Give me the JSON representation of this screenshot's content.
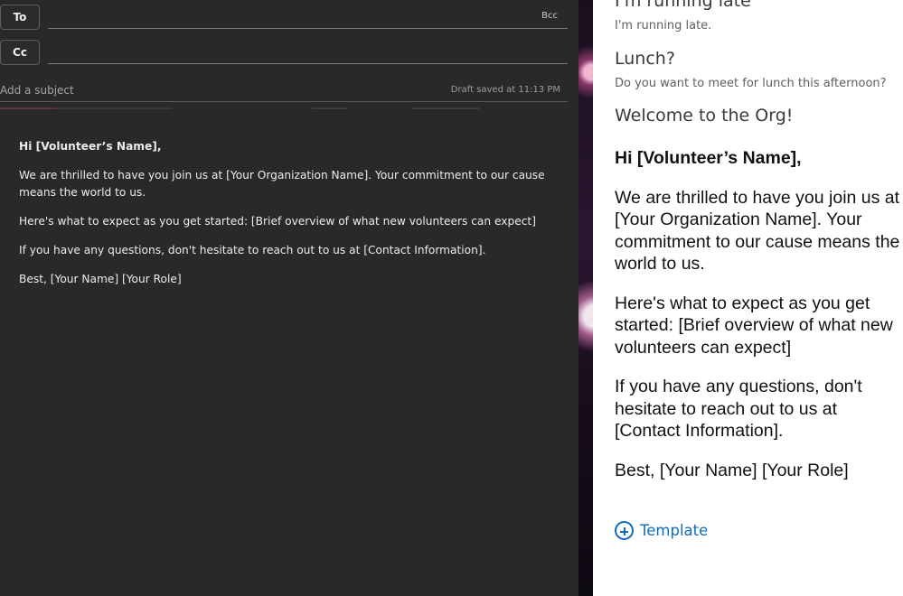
{
  "compose": {
    "to_label": "To",
    "cc_label": "Cc",
    "bcc_label": "Bcc",
    "to_value": "",
    "cc_value": "",
    "subject_placeholder": "Add a subject",
    "subject_value": "",
    "draft_status": "Draft saved at 11:13 PM",
    "body": {
      "greeting": "Hi [Volunteer’s Name],",
      "paragraphs": [
        "We are thrilled to have you join us at [Your Organization Name]. Your commitment to our cause means the world to us.",
        "Here's what to expect as you get started: [Brief overview of what new volunteers can expect]",
        "If you have any questions, don't hesitate to reach out to us at [Contact Information].",
        "Best, [Your Name] [Your Role]"
      ]
    }
  },
  "templates": {
    "items": [
      {
        "title": "I'm running late",
        "preview": "I'm running late."
      },
      {
        "title": "Lunch?",
        "preview": "Do you want to meet for lunch this afternoon?"
      },
      {
        "title": "Welcome to the Org!",
        "body": {
          "greeting": "Hi [Volunteer’s Name],",
          "paragraphs": [
            "We are thrilled to have you join us at [Your Organization Name]. Your commitment to our cause means the world to us.",
            "Here's what to expect as you get started: [Brief overview of what new volunteers can expect]",
            "If you have any questions, don't hesitate to reach out to us at [Contact Information].",
            "Best, [Your Name] [Your Role]"
          ]
        }
      }
    ],
    "add_label": "Template",
    "add_icon": "add-circle-icon",
    "accent_color": "#0f6cbd"
  },
  "colors": {
    "compose_bg": "#292929",
    "pane_bg": "#ffffff"
  }
}
